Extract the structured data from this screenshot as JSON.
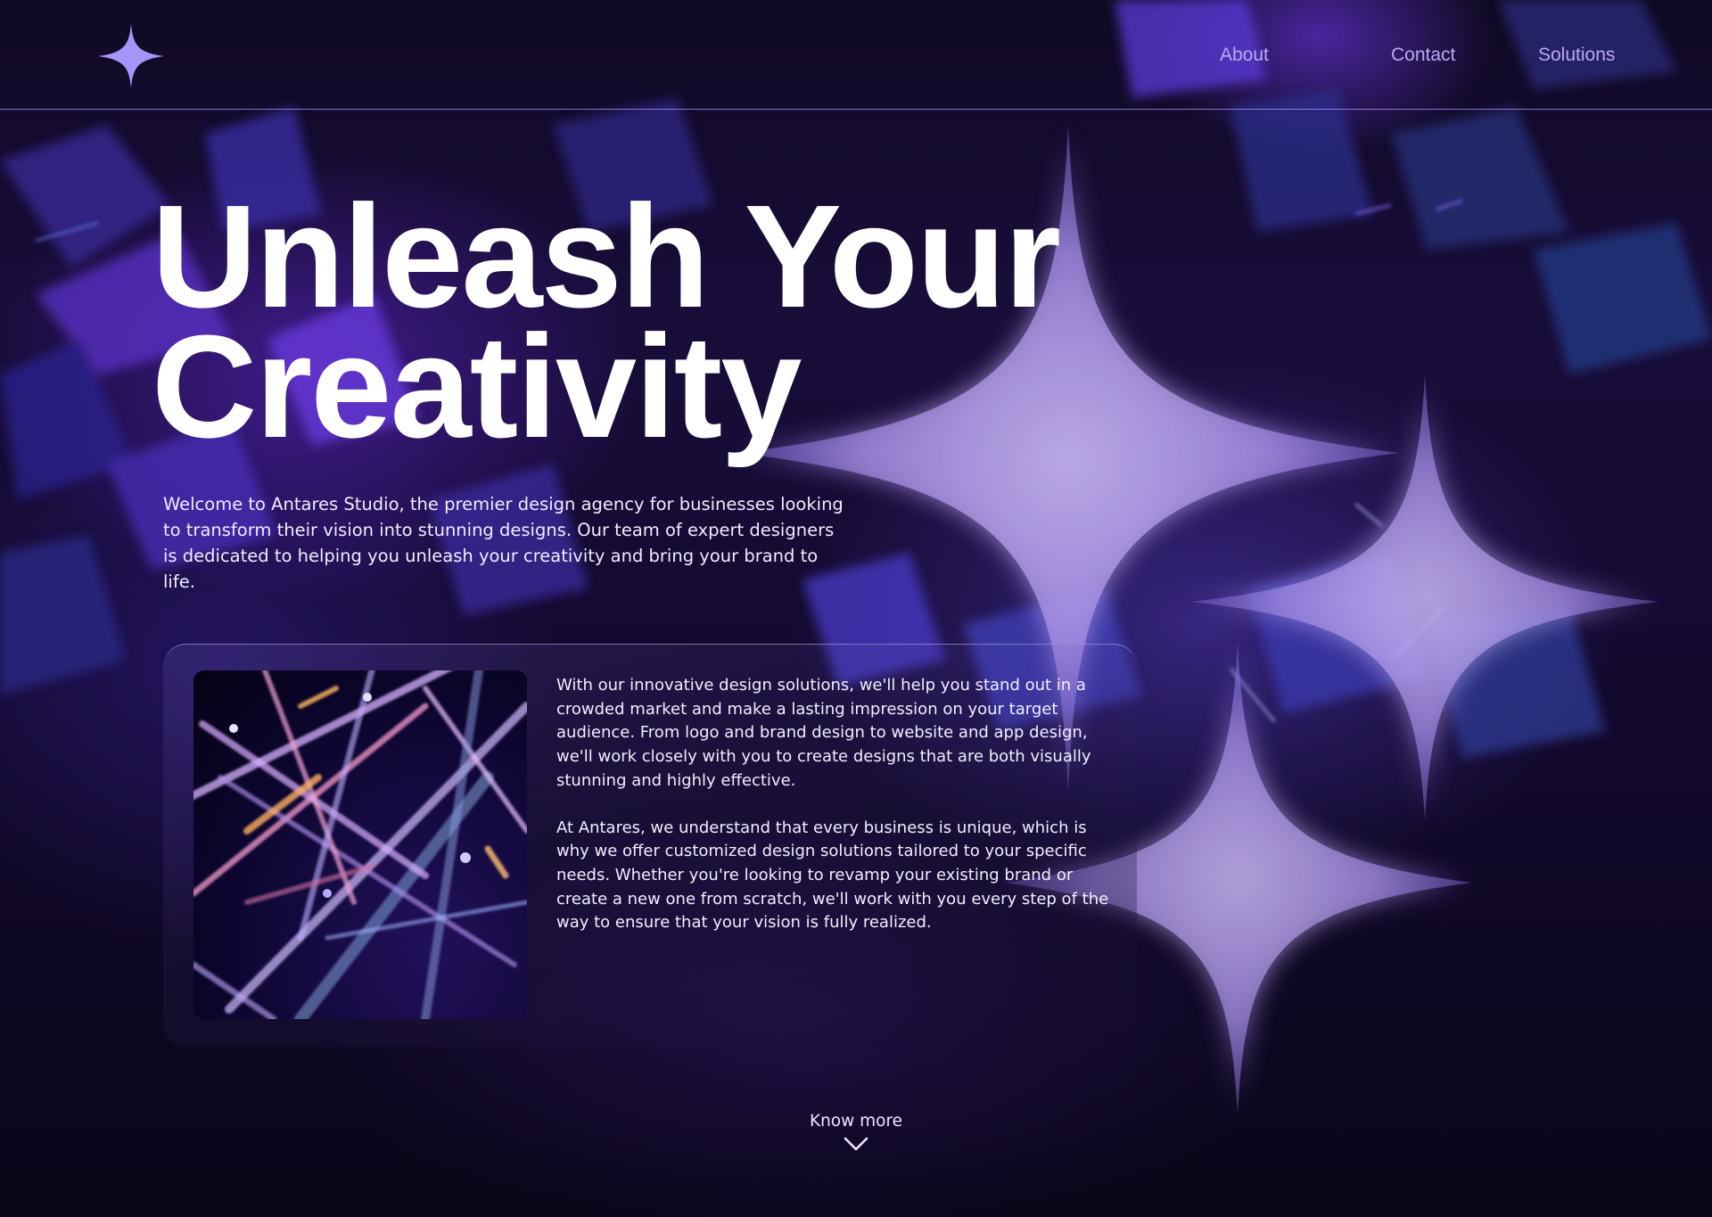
{
  "header": {
    "logo": "four-point-star-logo",
    "nav": [
      {
        "label": "About"
      },
      {
        "label": "Contact"
      },
      {
        "label": "Solutions"
      }
    ]
  },
  "hero": {
    "title_line1": "Unleash Your",
    "title_line2": "Creativity",
    "intro": "Welcome to Antares Studio, the premier design agency for businesses looking to transform their vision into stunning designs. Our team of expert designers is dedicated to helping you unleash your creativity and bring your brand to life."
  },
  "card": {
    "paragraphs": [
      "With our innovative design solutions, we'll help you stand out in a crowded market and make a lasting impression on your target audience. From logo and brand design to website and app design, we'll work closely with you to create designs that are both visually stunning and highly effective.",
      "At Antares, we understand that every business is unique, which is why we offer customized design solutions tailored to your specific needs. Whether you're looking to revamp your existing brand or create a new one from scratch, we'll work with you every step of the way to ensure that your vision is fully realized."
    ]
  },
  "cta": {
    "label": "Know more",
    "icon": "chevron-down-icon"
  },
  "colors": {
    "background": "#0c0719",
    "accent": "#a393f5",
    "nav_text": "#b9aaf0",
    "text": "#ffffff"
  }
}
